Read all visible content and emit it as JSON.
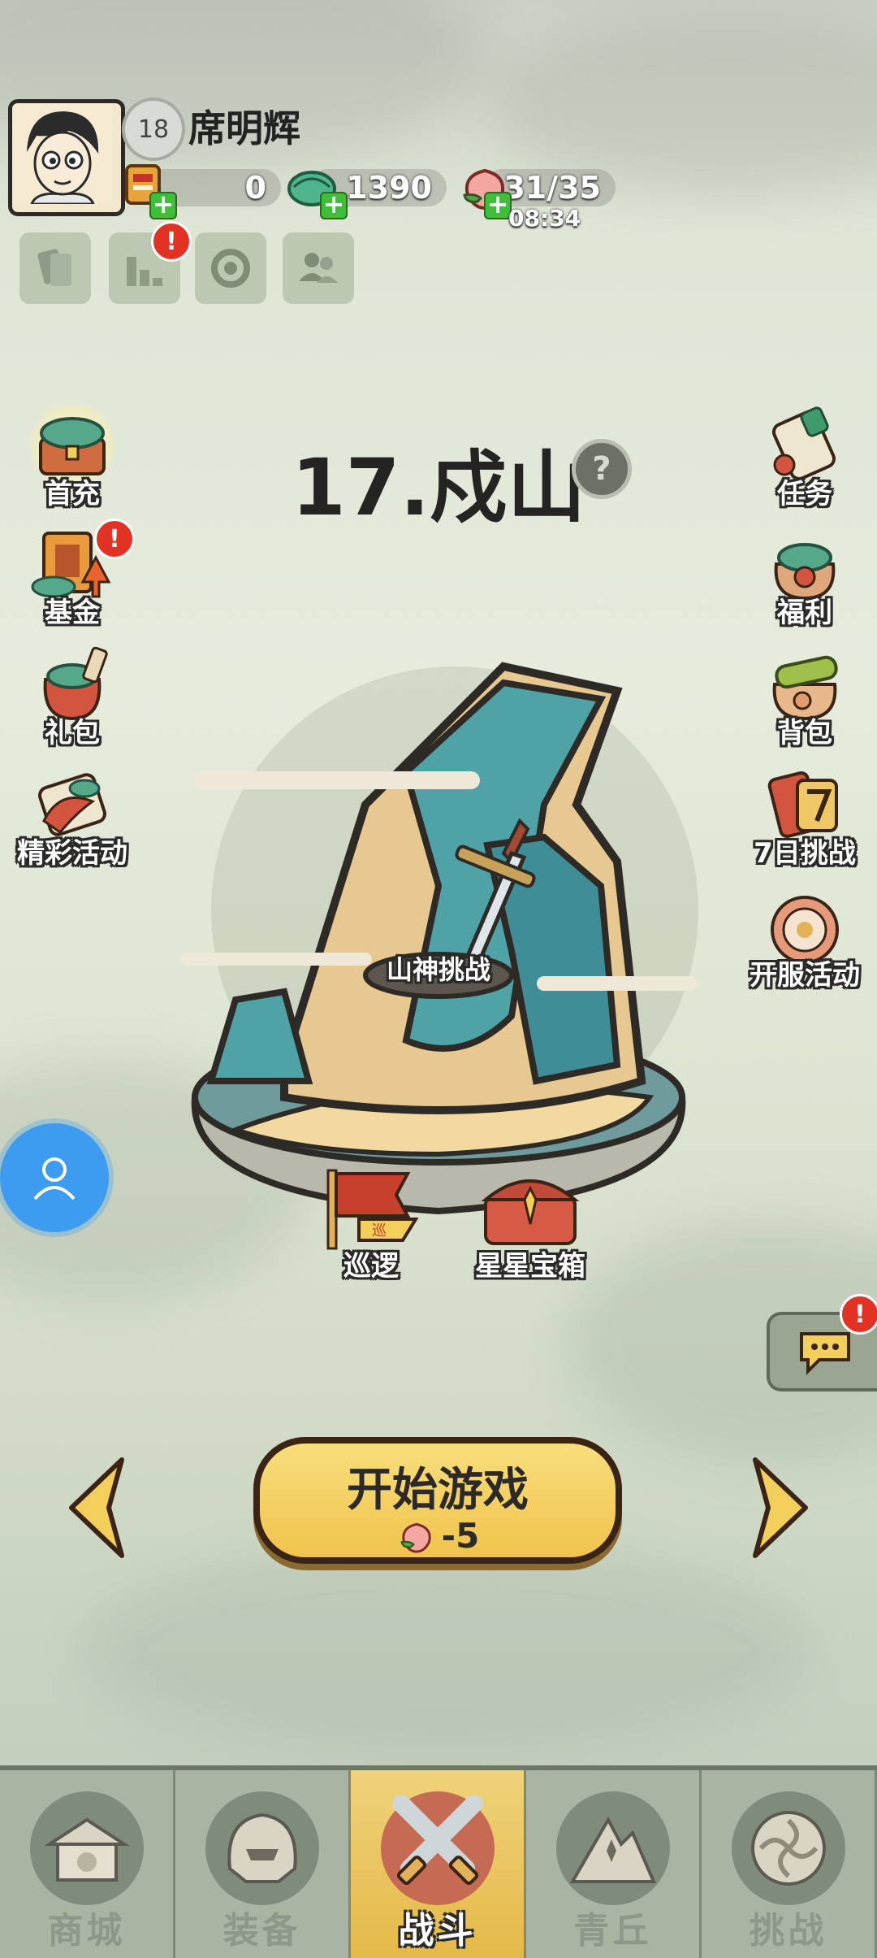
{
  "player": {
    "level": "18",
    "name": "席明辉"
  },
  "resources": {
    "coins": "0",
    "jade": "1390",
    "stamina": "31/35",
    "stamina_timer": "08:34"
  },
  "tools": {
    "alert_mark": "!"
  },
  "left_menu": [
    {
      "label": "首充",
      "icon": "first-recharge-chest-icon"
    },
    {
      "label": "基金",
      "icon": "fund-book-icon"
    },
    {
      "label": "礼包",
      "icon": "gift-pack-icon"
    },
    {
      "label": "精彩活动",
      "icon": "events-scroll-icon"
    }
  ],
  "right_menu": [
    {
      "label": "任务",
      "icon": "task-scroll-icon"
    },
    {
      "label": "福利",
      "icon": "welfare-bag-icon"
    },
    {
      "label": "背包",
      "icon": "backpack-icon"
    },
    {
      "label": "7日挑战",
      "icon": "seven-day-challenge-icon"
    },
    {
      "label": "开服活动",
      "icon": "server-open-event-icon"
    }
  ],
  "level": {
    "title": "17.戍山",
    "help": "?"
  },
  "stage": {
    "boss_label": "山神挑战",
    "patrol_label": "巡逻",
    "chest_label": "星星宝箱",
    "patrol_flag_char": "巡"
  },
  "start": {
    "label": "开始游戏",
    "cost": "-5"
  },
  "bottom_nav": [
    {
      "label": "商城",
      "active": false
    },
    {
      "label": "装备",
      "active": false
    },
    {
      "label": "战斗",
      "active": true
    },
    {
      "label": "青丘",
      "active": false
    },
    {
      "label": "挑战",
      "active": false
    }
  ],
  "colors": {
    "accent_gold": "#f2cf5b",
    "alert_red": "#e23224",
    "float_blue": "#3d9cf0"
  }
}
